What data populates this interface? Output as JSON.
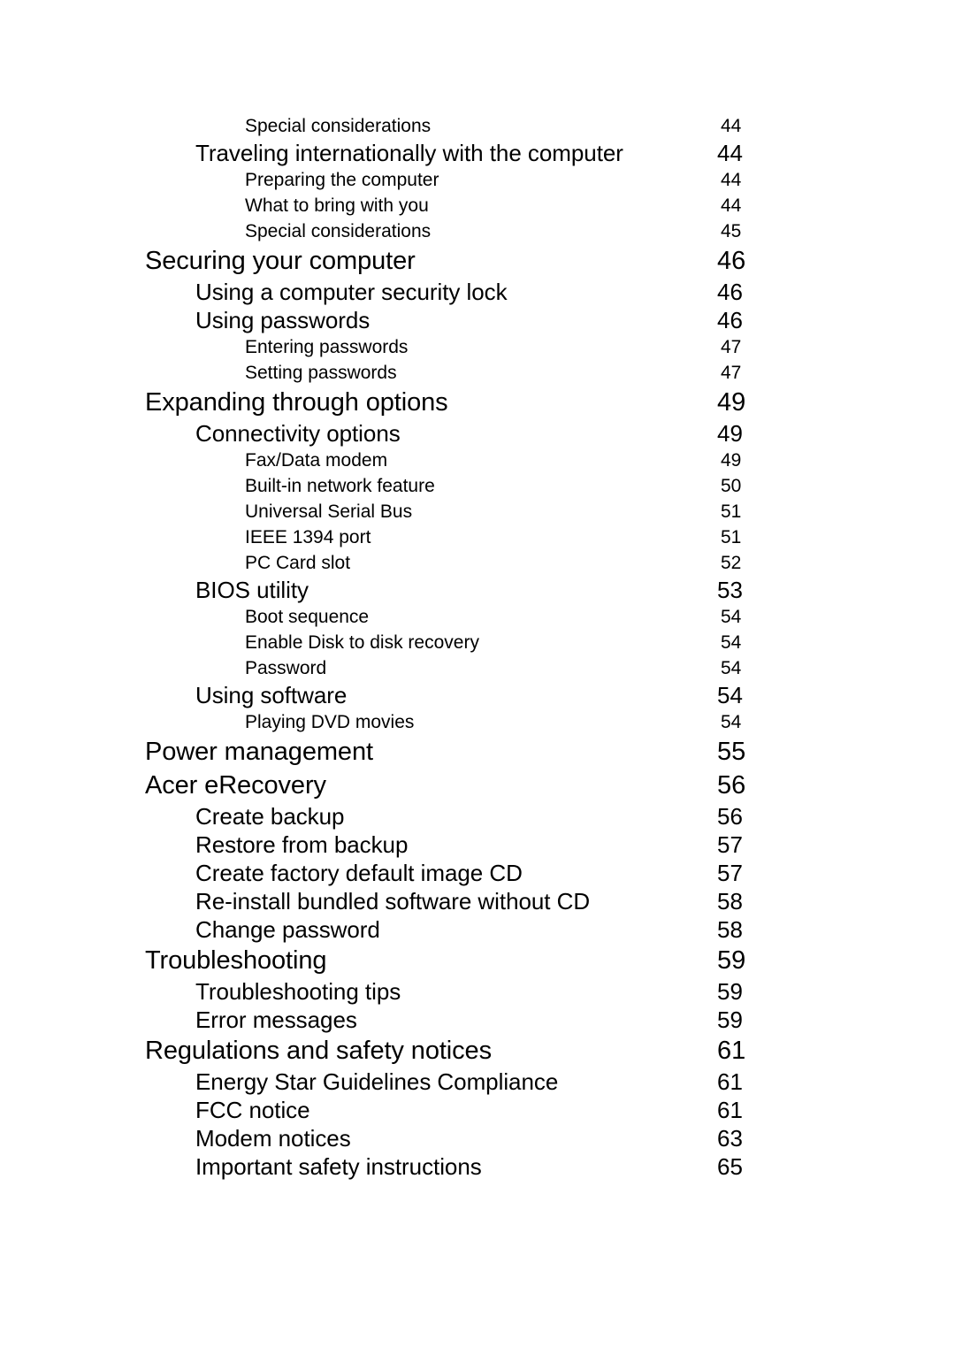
{
  "document": {
    "type": "table-of-contents",
    "page_background": "#ffffff",
    "text_color": "#000000"
  },
  "toc": {
    "entries": [
      {
        "label": "Special considerations",
        "page": "44",
        "level": 3
      },
      {
        "label": "Traveling internationally with the computer",
        "page": "44",
        "level": 2
      },
      {
        "label": "Preparing the computer",
        "page": "44",
        "level": 3
      },
      {
        "label": "What to bring with you",
        "page": "44",
        "level": 3
      },
      {
        "label": "Special considerations",
        "page": "45",
        "level": 3
      },
      {
        "label": "Securing your computer",
        "page": "46",
        "level": 1
      },
      {
        "label": "Using a computer security lock",
        "page": "46",
        "level": 2
      },
      {
        "label": "Using passwords",
        "page": "46",
        "level": 2
      },
      {
        "label": "Entering passwords",
        "page": "47",
        "level": 3
      },
      {
        "label": "Setting passwords",
        "page": "47",
        "level": 3
      },
      {
        "label": "Expanding through options",
        "page": "49",
        "level": 1
      },
      {
        "label": "Connectivity options",
        "page": "49",
        "level": 2
      },
      {
        "label": "Fax/Data modem",
        "page": "49",
        "level": 3
      },
      {
        "label": "Built-in network feature",
        "page": "50",
        "level": 3
      },
      {
        "label": "Universal Serial Bus",
        "page": "51",
        "level": 3
      },
      {
        "label": "IEEE 1394 port",
        "page": "51",
        "level": 3
      },
      {
        "label": "PC Card slot",
        "page": "52",
        "level": 3
      },
      {
        "label": "BIOS utility",
        "page": "53",
        "level": 2
      },
      {
        "label": "Boot sequence",
        "page": "54",
        "level": 3
      },
      {
        "label": "Enable Disk to disk recovery",
        "page": "54",
        "level": 3
      },
      {
        "label": "Password",
        "page": "54",
        "level": 3
      },
      {
        "label": "Using software",
        "page": "54",
        "level": 2
      },
      {
        "label": "Playing DVD movies",
        "page": "54",
        "level": 3
      },
      {
        "label": "Power management",
        "page": "55",
        "level": 1
      },
      {
        "label": "Acer eRecovery",
        "page": "56",
        "level": 1
      },
      {
        "label": "Create backup",
        "page": "56",
        "level": 2
      },
      {
        "label": "Restore from backup",
        "page": "57",
        "level": 2
      },
      {
        "label": "Create factory default image CD",
        "page": "57",
        "level": 2
      },
      {
        "label": "Re-install bundled software without CD",
        "page": "58",
        "level": 2
      },
      {
        "label": "Change password",
        "page": "58",
        "level": 2
      },
      {
        "label": "Troubleshooting",
        "page": "59",
        "level": 1
      },
      {
        "label": "Troubleshooting tips",
        "page": "59",
        "level": 2
      },
      {
        "label": "Error messages",
        "page": "59",
        "level": 2
      },
      {
        "label": "Regulations and safety notices",
        "page": "61",
        "level": 1
      },
      {
        "label": "Energy Star Guidelines Compliance",
        "page": "61",
        "level": 2
      },
      {
        "label": "FCC notice",
        "page": "61",
        "level": 2
      },
      {
        "label": "Modem notices",
        "page": "63",
        "level": 2
      },
      {
        "label": "Important safety instructions",
        "page": "65",
        "level": 2
      }
    ]
  }
}
